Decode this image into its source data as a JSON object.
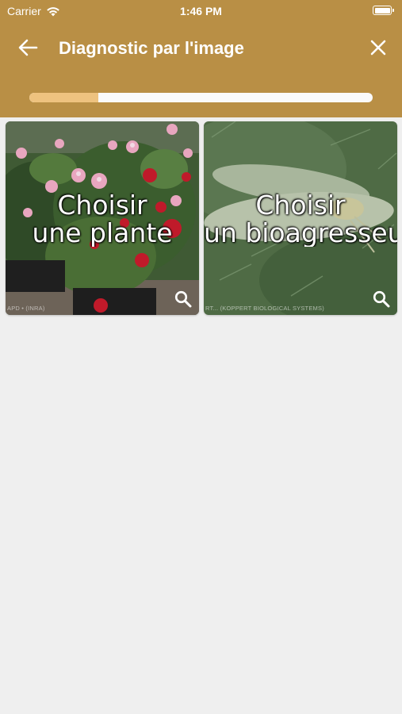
{
  "status_bar": {
    "carrier": "Carrier",
    "time": "1:46 PM",
    "icons": [
      "wifi-icon",
      "battery-icon"
    ]
  },
  "header": {
    "title": "Diagnostic par l'image",
    "back_icon": "arrow-left-icon",
    "close_icon": "close-icon",
    "background_color": "#b98f45"
  },
  "progress": {
    "value_fraction": 0.2,
    "fill_color": "#eec27f",
    "track_color": "#fafafa"
  },
  "cards": [
    {
      "id": "plant",
      "label_line1": "Choisir",
      "label_line2": "une plante",
      "credit": "APD • (INRA)",
      "icon": "search-icon"
    },
    {
      "id": "pest",
      "label_line1": "Choisir",
      "label_line2": "un bioagresseur",
      "credit": "RT... (KOPPERT BIOLOGICAL SYSTEMS)",
      "icon": "search-icon"
    }
  ]
}
